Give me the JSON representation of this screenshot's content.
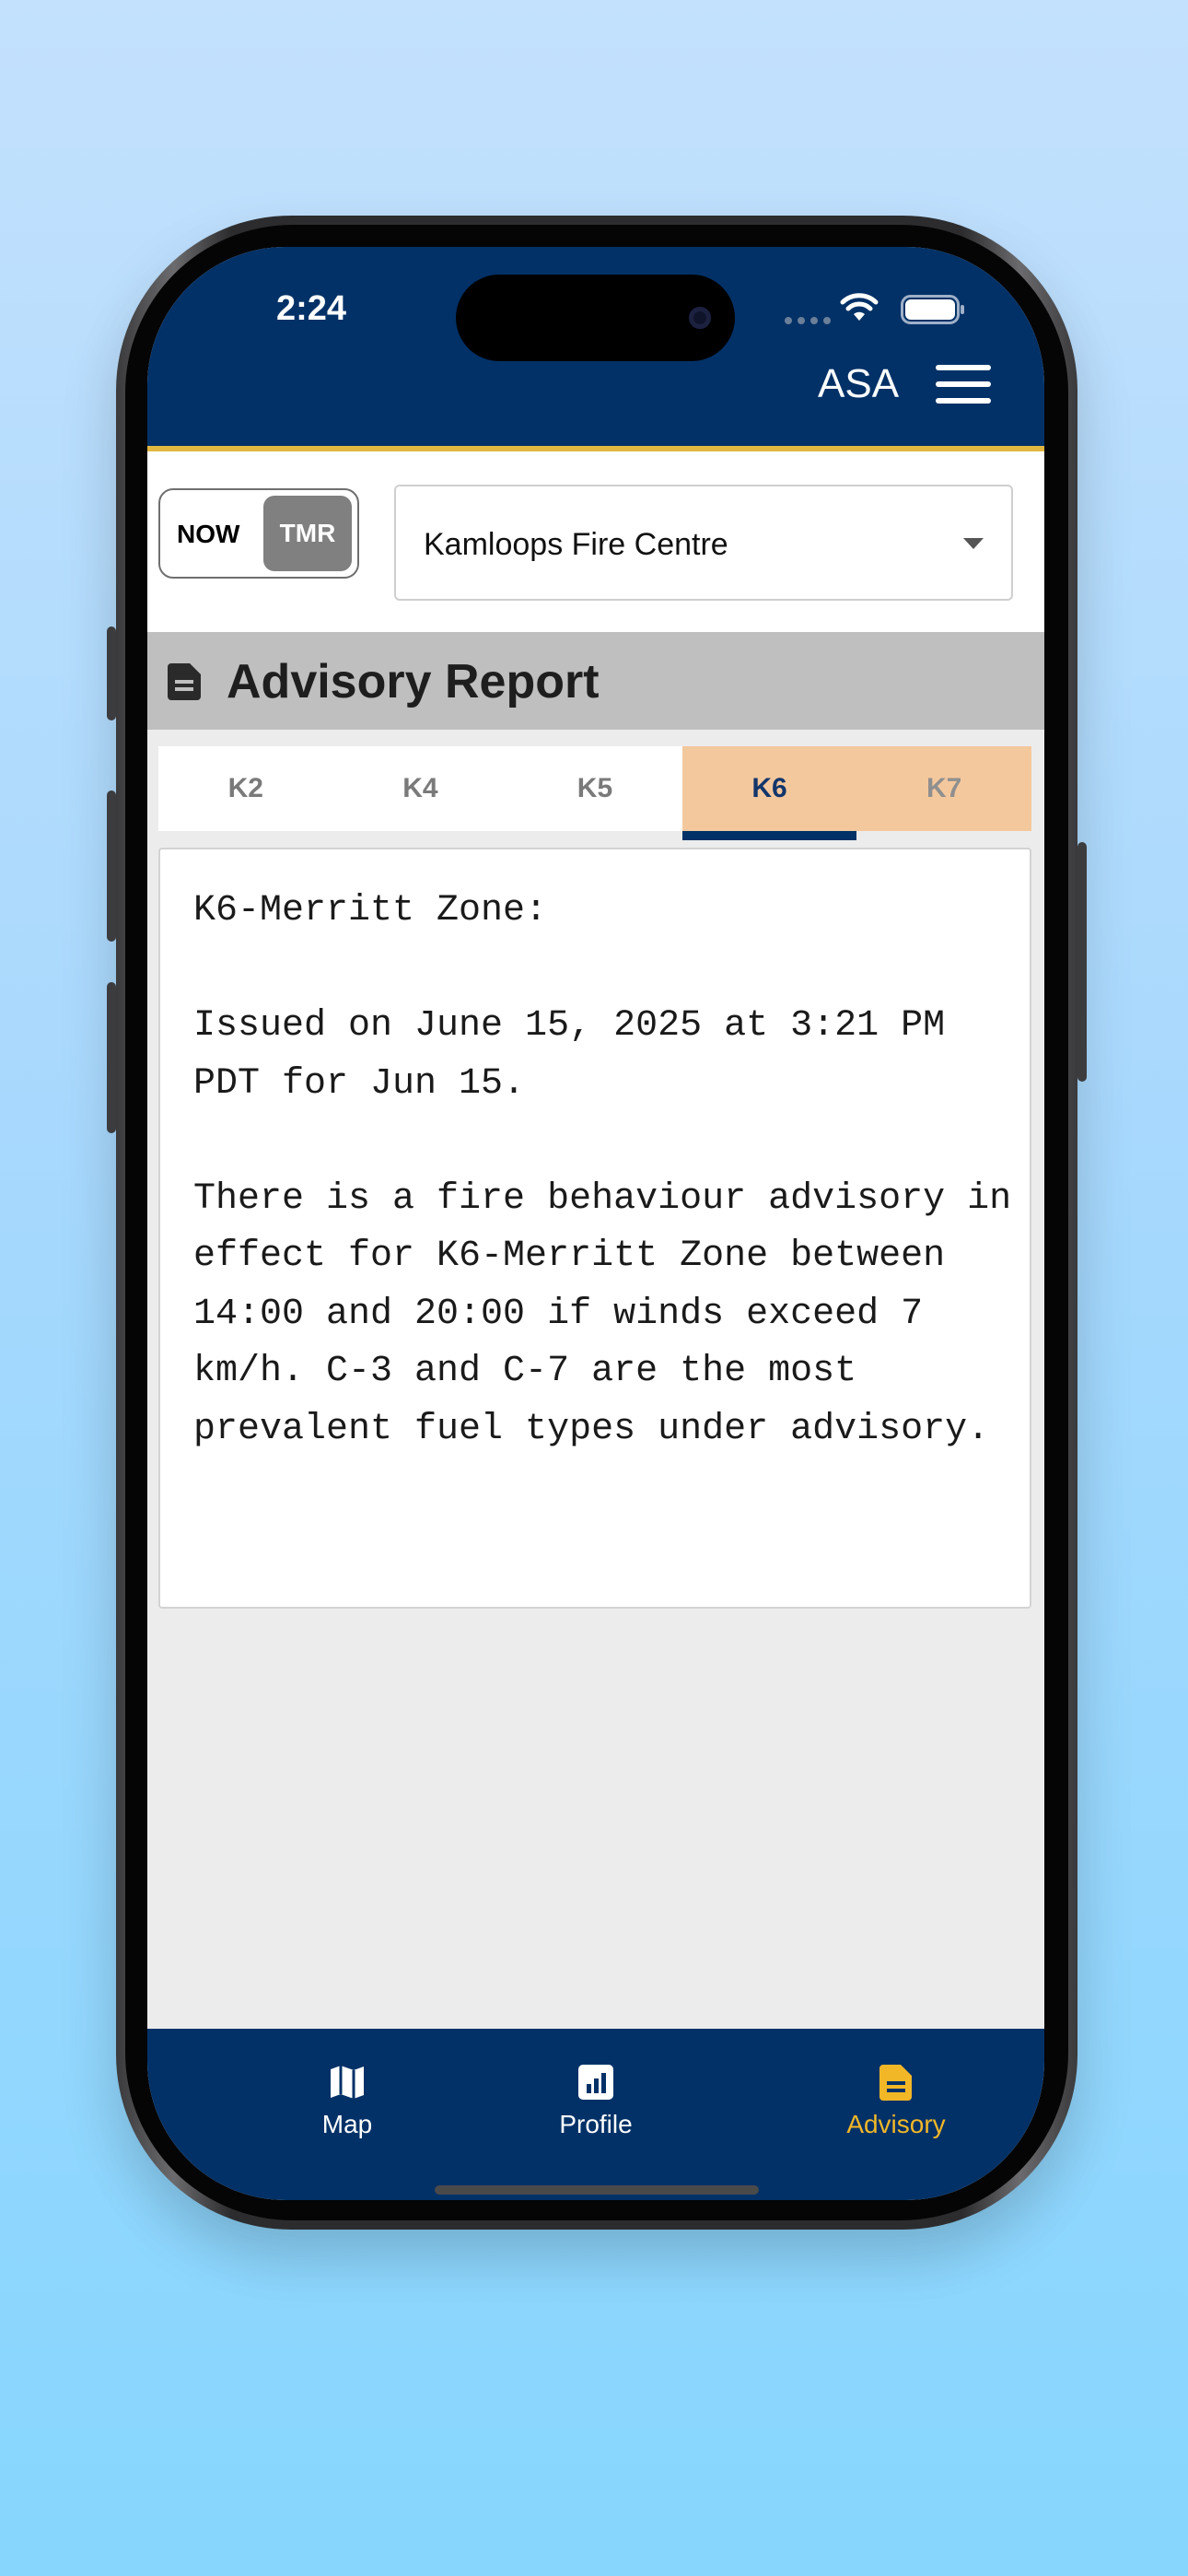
{
  "status_bar": {
    "time": "2:24"
  },
  "header": {
    "app_title": "ASA"
  },
  "day_toggle": {
    "now_label": "NOW",
    "tmr_label": "TMR",
    "selected": "TMR"
  },
  "fire_centre_select": {
    "value": "Kamloops Fire Centre"
  },
  "section": {
    "title": "Advisory Report"
  },
  "zone_tabs": [
    {
      "label": "K2",
      "advisory": false,
      "active": false
    },
    {
      "label": "K4",
      "advisory": false,
      "active": false
    },
    {
      "label": "K5",
      "advisory": false,
      "active": false
    },
    {
      "label": "K6",
      "advisory": true,
      "active": true
    },
    {
      "label": "K7",
      "advisory": true,
      "active": false
    }
  ],
  "report": {
    "zone_heading": "K6-Merritt Zone:",
    "issued": "Issued on June 15, 2025 at 3:21 PM PDT for Jun 15.",
    "body": "There is a fire behaviour advisory in effect for K6-Merritt Zone between 14:00 and 20:00 if winds exceed 7 km/h. C-3 and C-7 are the most prevalent fuel types under advisory."
  },
  "bottom_nav": [
    {
      "label": "Map",
      "icon": "map-icon",
      "active": false
    },
    {
      "label": "Profile",
      "icon": "bar-chart-icon",
      "active": false
    },
    {
      "label": "Advisory",
      "icon": "document-icon",
      "active": true
    }
  ],
  "colors": {
    "header_bg": "#023167",
    "header_accent": "#e1b742",
    "advisory_tab": "#f4c89d",
    "nav_active": "#f2b727"
  }
}
